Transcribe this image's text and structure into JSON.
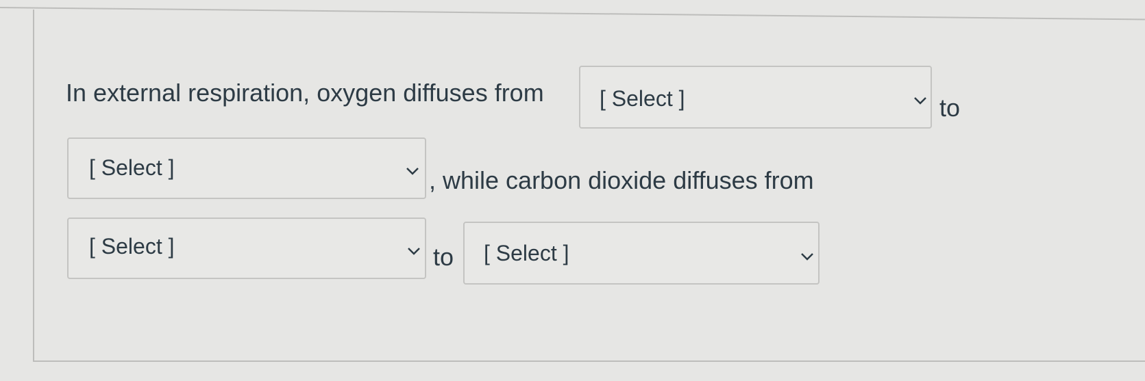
{
  "question": {
    "part1": "In external respiration, oxygen diffuses from",
    "part2": "to",
    "part3": ", while carbon dioxide diffuses from",
    "part4": "to"
  },
  "selects": [
    {
      "value": "[ Select ]",
      "icon": "chevron-down-icon"
    },
    {
      "value": "[ Select ]",
      "icon": "chevron-down-icon"
    },
    {
      "value": "[ Select ]",
      "icon": "chevron-down-icon"
    },
    {
      "value": "[ Select ]",
      "icon": "chevron-down-icon"
    }
  ]
}
